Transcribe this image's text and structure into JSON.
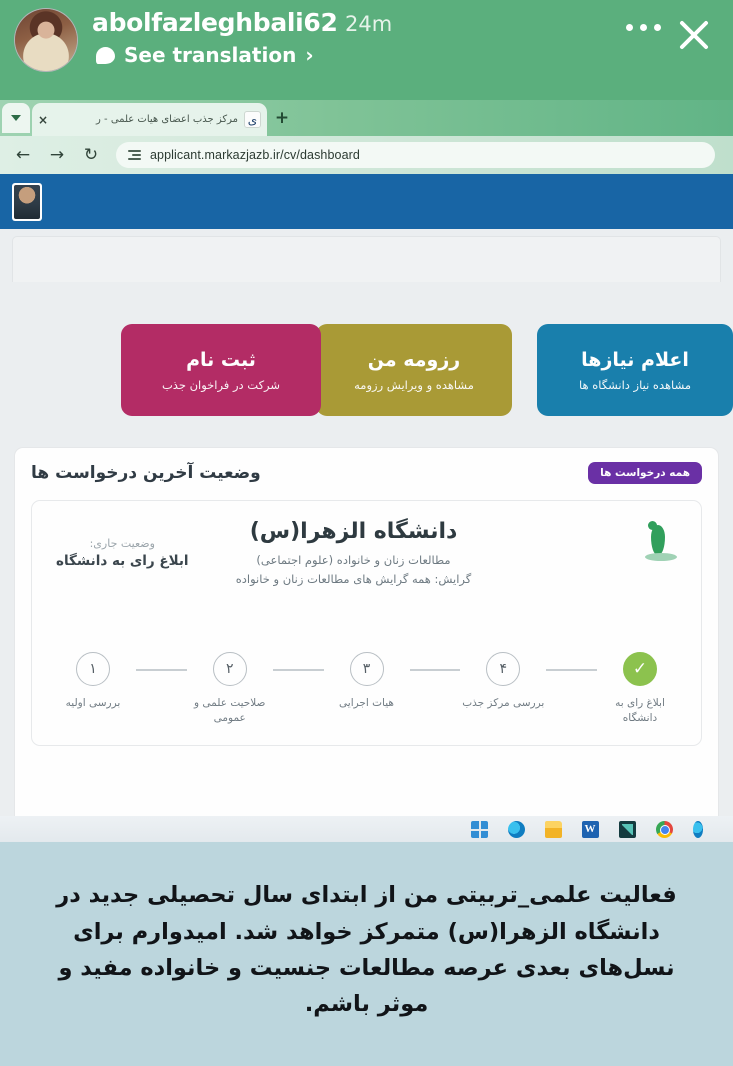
{
  "story": {
    "username": "abolfazleghbali62",
    "time": "24m",
    "see_translation": "See translation",
    "chevron": "›",
    "more_label": "more-options",
    "close_label": "×",
    "bg_color": "#5BAF7D"
  },
  "browser": {
    "tab": {
      "title": "مرکز جذب اعضای هیأت علمی - ر",
      "favicon_glyph": "ی",
      "close_glyph": "×",
      "new_tab_glyph": "+"
    },
    "toolbar": {
      "back": "←",
      "forward": "→",
      "reload": "↻",
      "url": "applicant.markazjazb.ir/cv/dashboard"
    }
  },
  "site": {
    "header_color": "#1565A8",
    "cards": [
      {
        "title": "اعلام نیازها",
        "subtitle": "مشاهده نیاز دانشگاه ها",
        "color": "#1580AE"
      },
      {
        "title": "رزومه من",
        "subtitle": "مشاهده و ویرایش رزومه",
        "color": "#AA9A32"
      },
      {
        "title": "ثبت نام",
        "subtitle": "شرکت در فراخوان جذب",
        "color": "#B72A65"
      }
    ],
    "requests": {
      "title": "وضعیت آخرین درخواست ها",
      "badge": "همه درخواست ها",
      "badge_color": "#6B2FA8",
      "university": "دانشگاه الزهرا(س)",
      "field": "مطالعات زنان و خانواده (علوم اجتماعی)",
      "orientation": "گرایش: همه گرایش های مطالعات زنان و خانواده",
      "status_label": "وضعیت جاری:",
      "status_value": "ابلاغ رای به دانشگاه",
      "steps": [
        {
          "num": "۱",
          "label": "بررسی اولیه",
          "done": false
        },
        {
          "num": "۲",
          "label": "صلاحیت علمی و عمومی",
          "done": false
        },
        {
          "num": "۳",
          "label": "هیات اجرایی",
          "done": false
        },
        {
          "num": "۴",
          "label": "بررسی مرکز جذب",
          "done": false
        },
        {
          "num": "✓",
          "label": "ابلاغ رای به دانشگاه",
          "done": true
        }
      ],
      "done_color": "#8BC34A"
    }
  },
  "taskbar": {
    "items": [
      "start-icon",
      "edge-icon",
      "file-explorer-icon",
      "word-icon",
      "app-icon",
      "chrome-icon",
      "edge-partial-icon"
    ]
  },
  "caption": {
    "text": "فعالیت علمی_تربیتی من از ابتدای سال تحصیلی جدید در دانشگاه الزهرا(س) متمرکز خواهد شد. امیدوارم برای نسل‌های بعدی عرصه مطالعات جنسیت و خانواده مفید و موثر باشم.",
    "bg_color": "#BCD6DD"
  }
}
